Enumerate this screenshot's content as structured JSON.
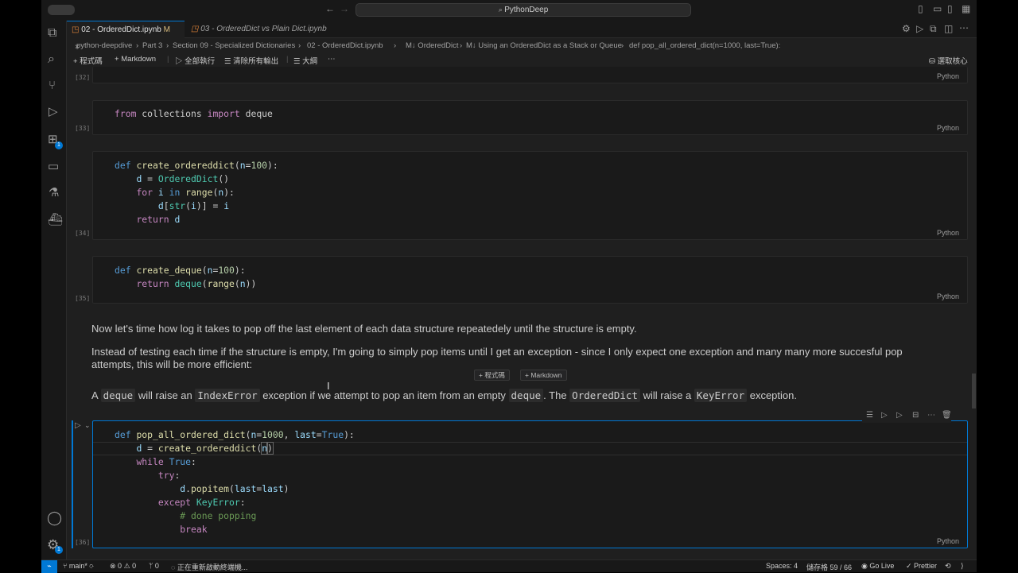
{
  "title_bar": {
    "search": "PythonDeep"
  },
  "tabs": [
    {
      "label": "02 - OrderedDict.ipynb",
      "badge": "M"
    },
    {
      "label": "03 - OrderedDict vs Plain Dict.ipynb"
    }
  ],
  "breadcrumb": {
    "items": [
      "python-deepdive",
      "Part 3",
      "Section 09 - Specialized Dictionaries",
      "02 - OrderedDict.ipynb",
      "M↓ OrderedDict",
      "M↓ Using an OrderedDict as a Stack or Queue",
      "def pop_all_ordered_dict(n=1000, last=True):"
    ]
  },
  "toolbar": {
    "code": "程式碼",
    "markdown": "Markdown",
    "run_all": "全部執行",
    "clear_outputs": "清除所有輸出",
    "outline": "大綱",
    "select_kernel": "選取核心"
  },
  "cells": {
    "c32": {
      "exec": "[32]",
      "lang": "Python"
    },
    "c33": {
      "exec": "[33]",
      "lang": "Python"
    },
    "c34": {
      "exec": "[34]",
      "lang": "Python"
    },
    "c35": {
      "exec": "[35]",
      "lang": "Python"
    },
    "c36": {
      "exec": "[36]",
      "lang": "Python"
    }
  },
  "markdown": {
    "p1": "Now let's time how log it takes to pop off the last element of each data structure repeatedely until the structure is empty.",
    "p2_line1": "Instead of testing each time if the structure is empty, I'm going to simply pop items until I get an exception - since I only expect one exception and many many more succesful pop",
    "p2_line2": "attempts, this will be more efficient:",
    "p3": {
      "a": "A ",
      "code1": "deque",
      "b": " will raise an ",
      "code2": "IndexError",
      "c": " exception if we attempt to pop an item from an empty ",
      "code3": "deque",
      "d": ". The ",
      "code4": "OrderedDict",
      "e": " will raise a ",
      "code5": "KeyError",
      "f": " exception."
    }
  },
  "insert_bar": {
    "code": "+ 程式碼",
    "markdown": "+ Markdown"
  },
  "status": {
    "branch": "main*",
    "errors": "0",
    "warnings": "0",
    "ports": "0",
    "message": "正在重新啟動終端機...",
    "spaces": "Spaces: 4",
    "cell_pos": "儲存格 59 / 66",
    "go_live": "Go Live",
    "prettier": "Prettier"
  }
}
